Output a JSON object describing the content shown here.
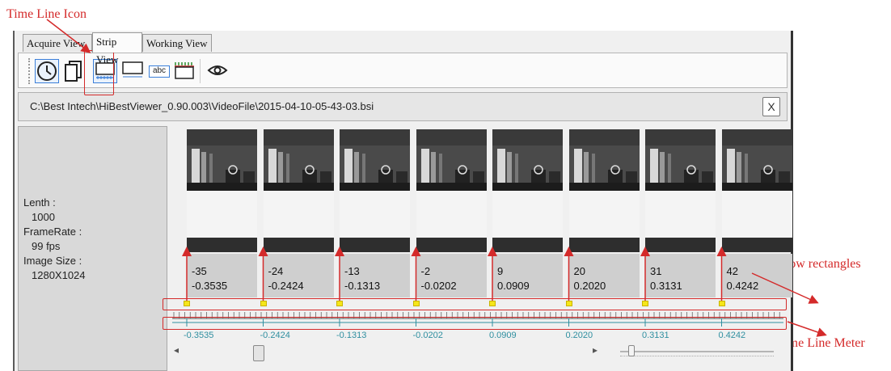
{
  "annotations": {
    "time_line_icon": "Time Line Icon",
    "yellow_rects": "List of yellow rectangles",
    "time_line_meter": "Time Line Meter"
  },
  "tabs": [
    {
      "label": "Acquire View",
      "active": false
    },
    {
      "label": "Strip View",
      "active": true
    },
    {
      "label": "Working View",
      "active": false
    }
  ],
  "toolbar": {
    "icons": [
      "clock-icon",
      "copy-icon",
      "timeline-strip-icon",
      "strip-icon",
      "text-abc-icon",
      "timeline-ruler-icon",
      "eye-icon"
    ],
    "abc_text": "abc"
  },
  "file_path": "C:\\Best Intech\\HiBestViewer_0.90.003\\VideoFile\\2015-04-10-05-43-03.bsi",
  "close_label": "X",
  "info": {
    "length_label": "Lenth :",
    "length_value": "1000",
    "framerate_label": "FrameRate :",
    "framerate_value": "99 fps",
    "image_size_label": "Image Size :",
    "image_size_value": "1280X1024"
  },
  "frames": [
    {
      "index": "-35",
      "time": "-0.3535"
    },
    {
      "index": "-24",
      "time": "-0.2424"
    },
    {
      "index": "-13",
      "time": "-0.1313"
    },
    {
      "index": "-2",
      "time": "-0.0202"
    },
    {
      "index": "9",
      "time": "0.0909"
    },
    {
      "index": "20",
      "time": "0.2020"
    },
    {
      "index": "31",
      "time": "0.3131"
    },
    {
      "index": "42",
      "time": "0.4242"
    }
  ],
  "meter_labels": [
    "-0.3535",
    "-0.2424",
    "-0.1313",
    "-0.0202",
    "0.0909",
    "0.2020",
    "0.3131",
    "0.4242"
  ],
  "scroll": {
    "left_arrow": "◂",
    "right_arrow": "▸"
  },
  "colors": {
    "annotation": "#d42a2a",
    "yellow": "#f5e61a",
    "meter_text": "#2f8fa0",
    "toolbar_active": "#3b7fd9"
  }
}
